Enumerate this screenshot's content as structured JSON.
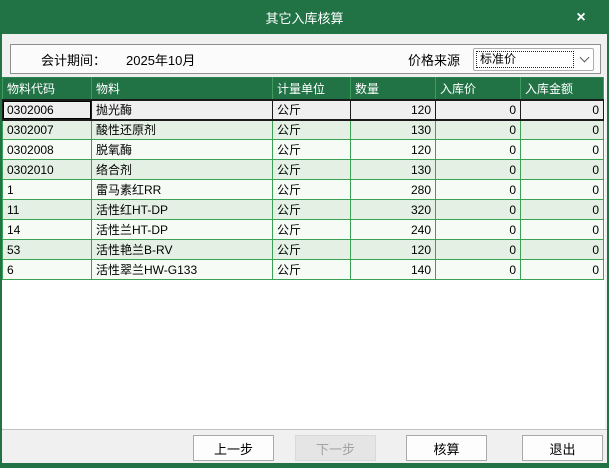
{
  "window": {
    "title": "其它入库核算",
    "close_label": "×"
  },
  "filters": {
    "period_label": "会计期间：",
    "period_value": "2025年10月",
    "price_source_label": "价格来源",
    "price_source_value": "标准价",
    "chevron_icon": "chevron-down"
  },
  "table": {
    "columns": [
      "物料代码",
      "物料",
      "计量单位",
      "数量",
      "入库价",
      "入库金额"
    ],
    "rows": [
      {
        "code": "0302006",
        "name": "抛光酶",
        "unit": "公斤",
        "qty": "120",
        "price": "0",
        "amount": "0"
      },
      {
        "code": "0302007",
        "name": "酸性还原剂",
        "unit": "公斤",
        "qty": "130",
        "price": "0",
        "amount": "0"
      },
      {
        "code": "0302008",
        "name": "脱氧酶",
        "unit": "公斤",
        "qty": "120",
        "price": "0",
        "amount": "0"
      },
      {
        "code": "0302010",
        "name": "络合剂",
        "unit": "公斤",
        "qty": "130",
        "price": "0",
        "amount": "0"
      },
      {
        "code": "1",
        "name": "雷马素红RR",
        "unit": "公斤",
        "qty": "280",
        "price": "0",
        "amount": "0"
      },
      {
        "code": "11",
        "name": "活性红HT-DP",
        "unit": "公斤",
        "qty": "320",
        "price": "0",
        "amount": "0"
      },
      {
        "code": "14",
        "name": "活性兰HT-DP",
        "unit": "公斤",
        "qty": "240",
        "price": "0",
        "amount": "0"
      },
      {
        "code": "53",
        "name": "活性艳兰B-RV",
        "unit": "公斤",
        "qty": "120",
        "price": "0",
        "amount": "0"
      },
      {
        "code": "6",
        "name": "活性翠兰HW-G133",
        "unit": "公斤",
        "qty": "140",
        "price": "0",
        "amount": "0"
      }
    ],
    "selected_row_index": 0
  },
  "footer": {
    "prev_label": "上一步",
    "next_label": "下一步",
    "next_disabled": true,
    "calc_label": "核算",
    "exit_label": "退出"
  },
  "colors": {
    "titlebar_green": "#217346",
    "grid_line_green": "#3ba155",
    "row_even_bg": "#e3f0e3",
    "row_odd_bg": "#f6fbf6",
    "selected_row_bg": "#efefef",
    "client_bg": "#f0f0f0"
  }
}
